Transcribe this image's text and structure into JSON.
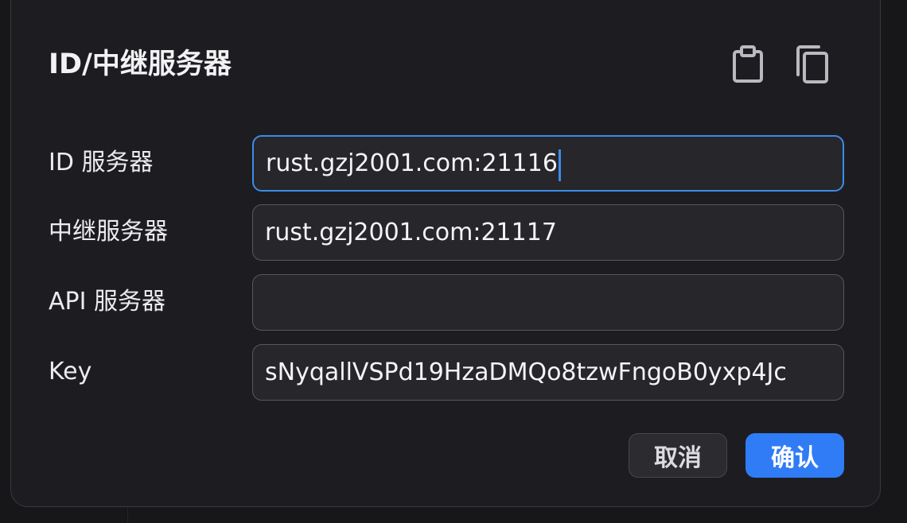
{
  "dialog": {
    "title": "ID/中继服务器",
    "paste_icon": "clipboard-icon",
    "copy_icon": "copy-icon"
  },
  "fields": [
    {
      "label": "ID 服务器",
      "value": "rust.gzj2001.com:21116"
    },
    {
      "label": "中继服务器",
      "value": "rust.gzj2001.com:21117"
    },
    {
      "label": "API 服务器",
      "value": ""
    },
    {
      "label": "Key",
      "value": "sNyqallVSPd19HzaDMQo8tzwFngoB0yxp4Jc"
    }
  ],
  "buttons": {
    "cancel_label": "取消",
    "ok_label": "确认"
  },
  "colors": {
    "accent": "#2f7cf6",
    "focus_border": "#3c8ce7",
    "dialog_bg": "#1d1d21",
    "field_bg": "#26262b"
  }
}
